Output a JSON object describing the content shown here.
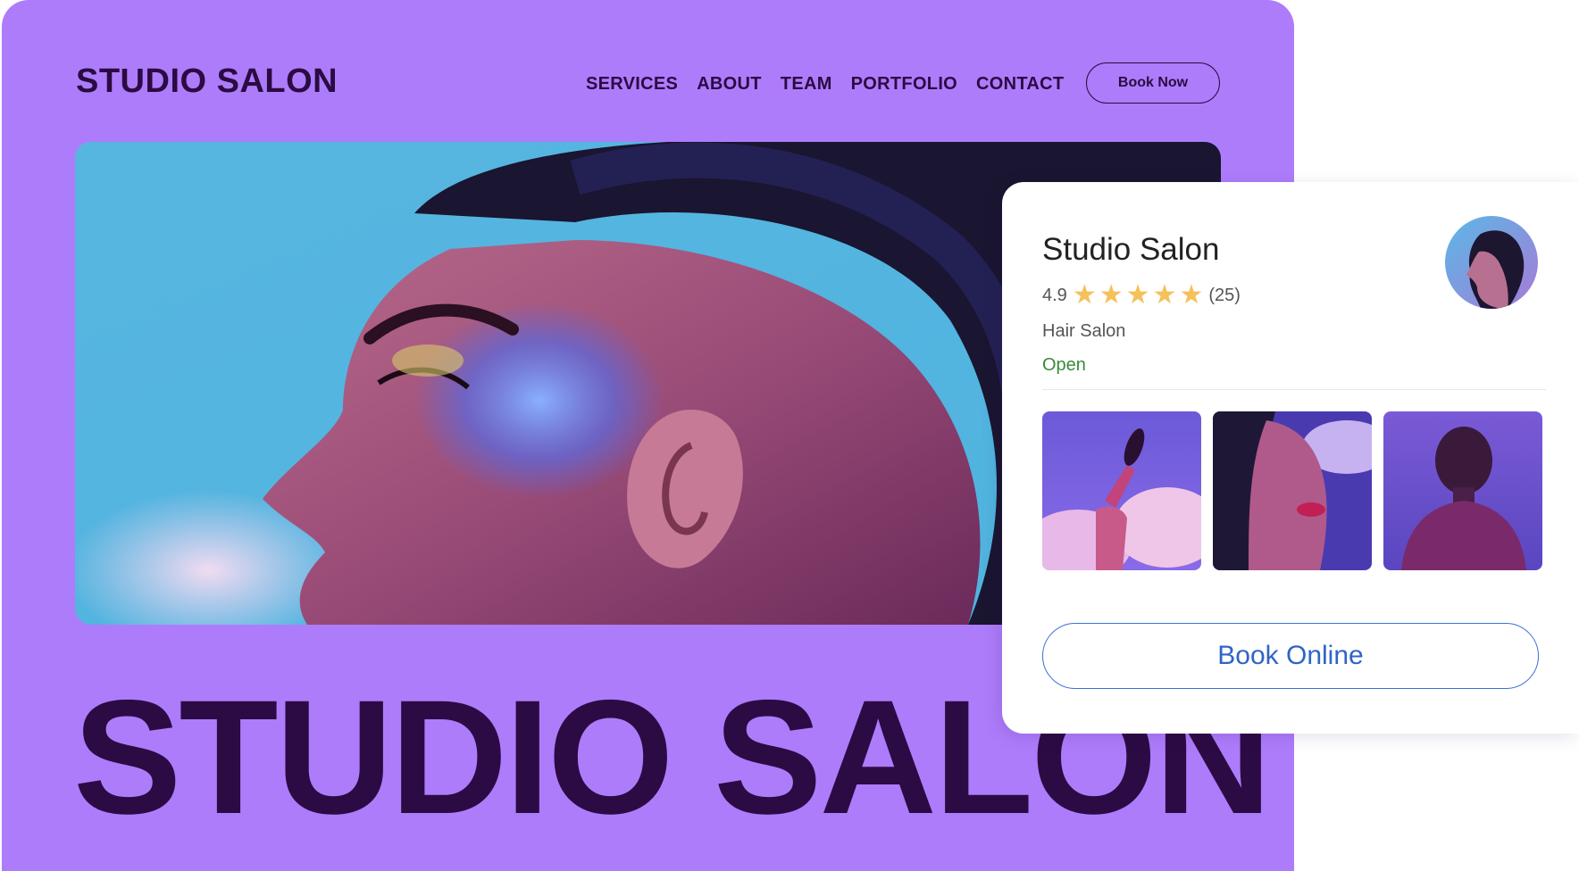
{
  "site": {
    "logo": "STUDIO SALON",
    "nav": [
      "SERVICES",
      "ABOUT",
      "TEAM",
      "PORTFOLIO",
      "CONTACT"
    ],
    "cta": "Book Now",
    "headline": "STUDIO SALON"
  },
  "card": {
    "title": "Studio Salon",
    "rating": "4.9",
    "stars": 5,
    "review_count": "(25)",
    "category": "Hair Salon",
    "status": "Open",
    "cta": "Book Online"
  },
  "colors": {
    "brand_purple": "#ad7cfb",
    "dark_purple": "#2a0b42",
    "star": "#f4c15a",
    "open_green": "#3a8a3a",
    "link_blue": "#2f64c8"
  }
}
